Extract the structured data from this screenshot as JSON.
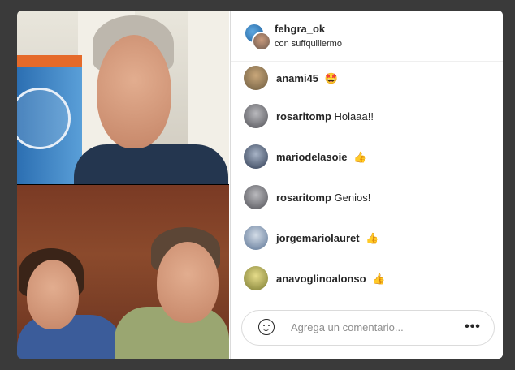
{
  "header": {
    "host_username": "fehgra_ok",
    "with_line": "con suffquillermo"
  },
  "comments": [
    {
      "user": "anami45",
      "text": "",
      "emoji": "🤩",
      "avatar_color": "#8a7a5a"
    },
    {
      "user": "rosaritomp",
      "text": "Holaaa!!",
      "emoji": "",
      "avatar_color": "#6f6f73"
    },
    {
      "user": "mariodelasoie",
      "text": "",
      "emoji": "👍",
      "avatar_color": "#4a5a70"
    },
    {
      "user": "rosaritomp",
      "text": "Genios!",
      "emoji": "",
      "avatar_color": "#6f6f73"
    },
    {
      "user": "jorgemariolauret",
      "text": "",
      "emoji": "👍",
      "avatar_color": "#7a8ea8"
    },
    {
      "user": "anavoglinoalonso",
      "text": "",
      "emoji": "👍",
      "avatar_color": "#9a9a4a"
    }
  ],
  "comment_box": {
    "placeholder": "Agrega un comentario...",
    "more_label": "•••"
  }
}
